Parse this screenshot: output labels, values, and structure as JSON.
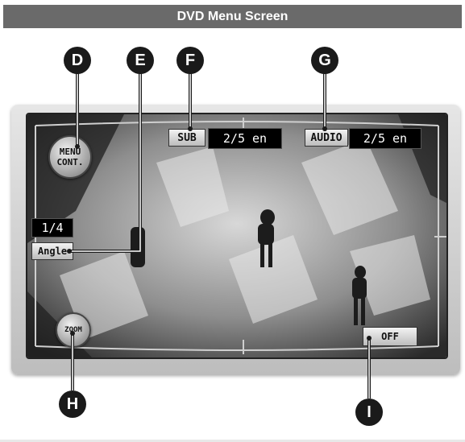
{
  "title": "DVD Menu Screen",
  "callouts": {
    "d": "D",
    "e": "E",
    "f": "F",
    "g": "G",
    "h": "H",
    "i": "I"
  },
  "controls": {
    "menu_cont_line1": "MENU",
    "menu_cont_line2": "CONT.",
    "sub_label": "SUB",
    "sub_value": "2/5 en",
    "audio_label": "AUDIO",
    "audio_value": "2/5 en",
    "angle_value": "1/4",
    "angle_label": "Angle",
    "zoom_label": "ZOOM",
    "off_label": "OFF"
  }
}
